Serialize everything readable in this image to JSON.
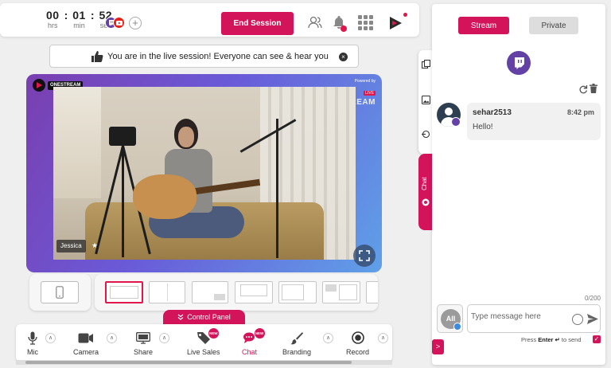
{
  "timer": {
    "hours": "00",
    "minutes": "01",
    "seconds": "52",
    "hours_label": "hrs",
    "minutes_label": "min",
    "seconds_label": "sec",
    "separator": ":"
  },
  "topbar": {
    "end_session_label": "End Session",
    "icons": [
      "twitch-channel-icon",
      "youtube-channel-icon",
      "add-channel-icon",
      "guests-icon",
      "notification-bell-icon",
      "apps-grid-icon",
      "onestream-logo-icon"
    ]
  },
  "notice": {
    "text": "You are in the live session! Everyone can see & hear you",
    "close_glyph": "×"
  },
  "stage": {
    "logo_text": "ONESTREAM",
    "powered_by": "Powered by",
    "live_badge": "LIVE",
    "brand_text": "ONESTREAM",
    "guest_name": "Jessica"
  },
  "control_panel": {
    "tab_label": "Control Panel",
    "items": [
      {
        "label": "Mic",
        "icon": "microphone-icon"
      },
      {
        "label": "Camera",
        "icon": "camera-icon"
      },
      {
        "label": "Share",
        "icon": "share-screen-icon"
      },
      {
        "label": "Live Sales",
        "icon": "tag-icon",
        "badge": "NEW"
      },
      {
        "label": "Chat",
        "icon": "chat-icon",
        "badge": "NEW"
      },
      {
        "label": "Branding",
        "icon": "brush-icon"
      },
      {
        "label": "Record",
        "icon": "record-icon"
      }
    ]
  },
  "side_tab": {
    "chat_label": "Chat"
  },
  "chat": {
    "tabs": [
      "Stream",
      "Private"
    ],
    "messages": [
      {
        "user": "sehar2513",
        "time": "8:42 pm",
        "text": "Hello!"
      }
    ],
    "counter": "0/200",
    "all_label": "All",
    "input_placeholder": "Type message here",
    "press_prefix": "Press",
    "press_key": "Enter ↵",
    "press_suffix": "to send",
    "checkbox_glyph": "✓",
    "expand_glyph": ">"
  },
  "colors": {
    "accent": "#d4145a",
    "twitch": "#6441a5",
    "youtube": "#e62117"
  }
}
